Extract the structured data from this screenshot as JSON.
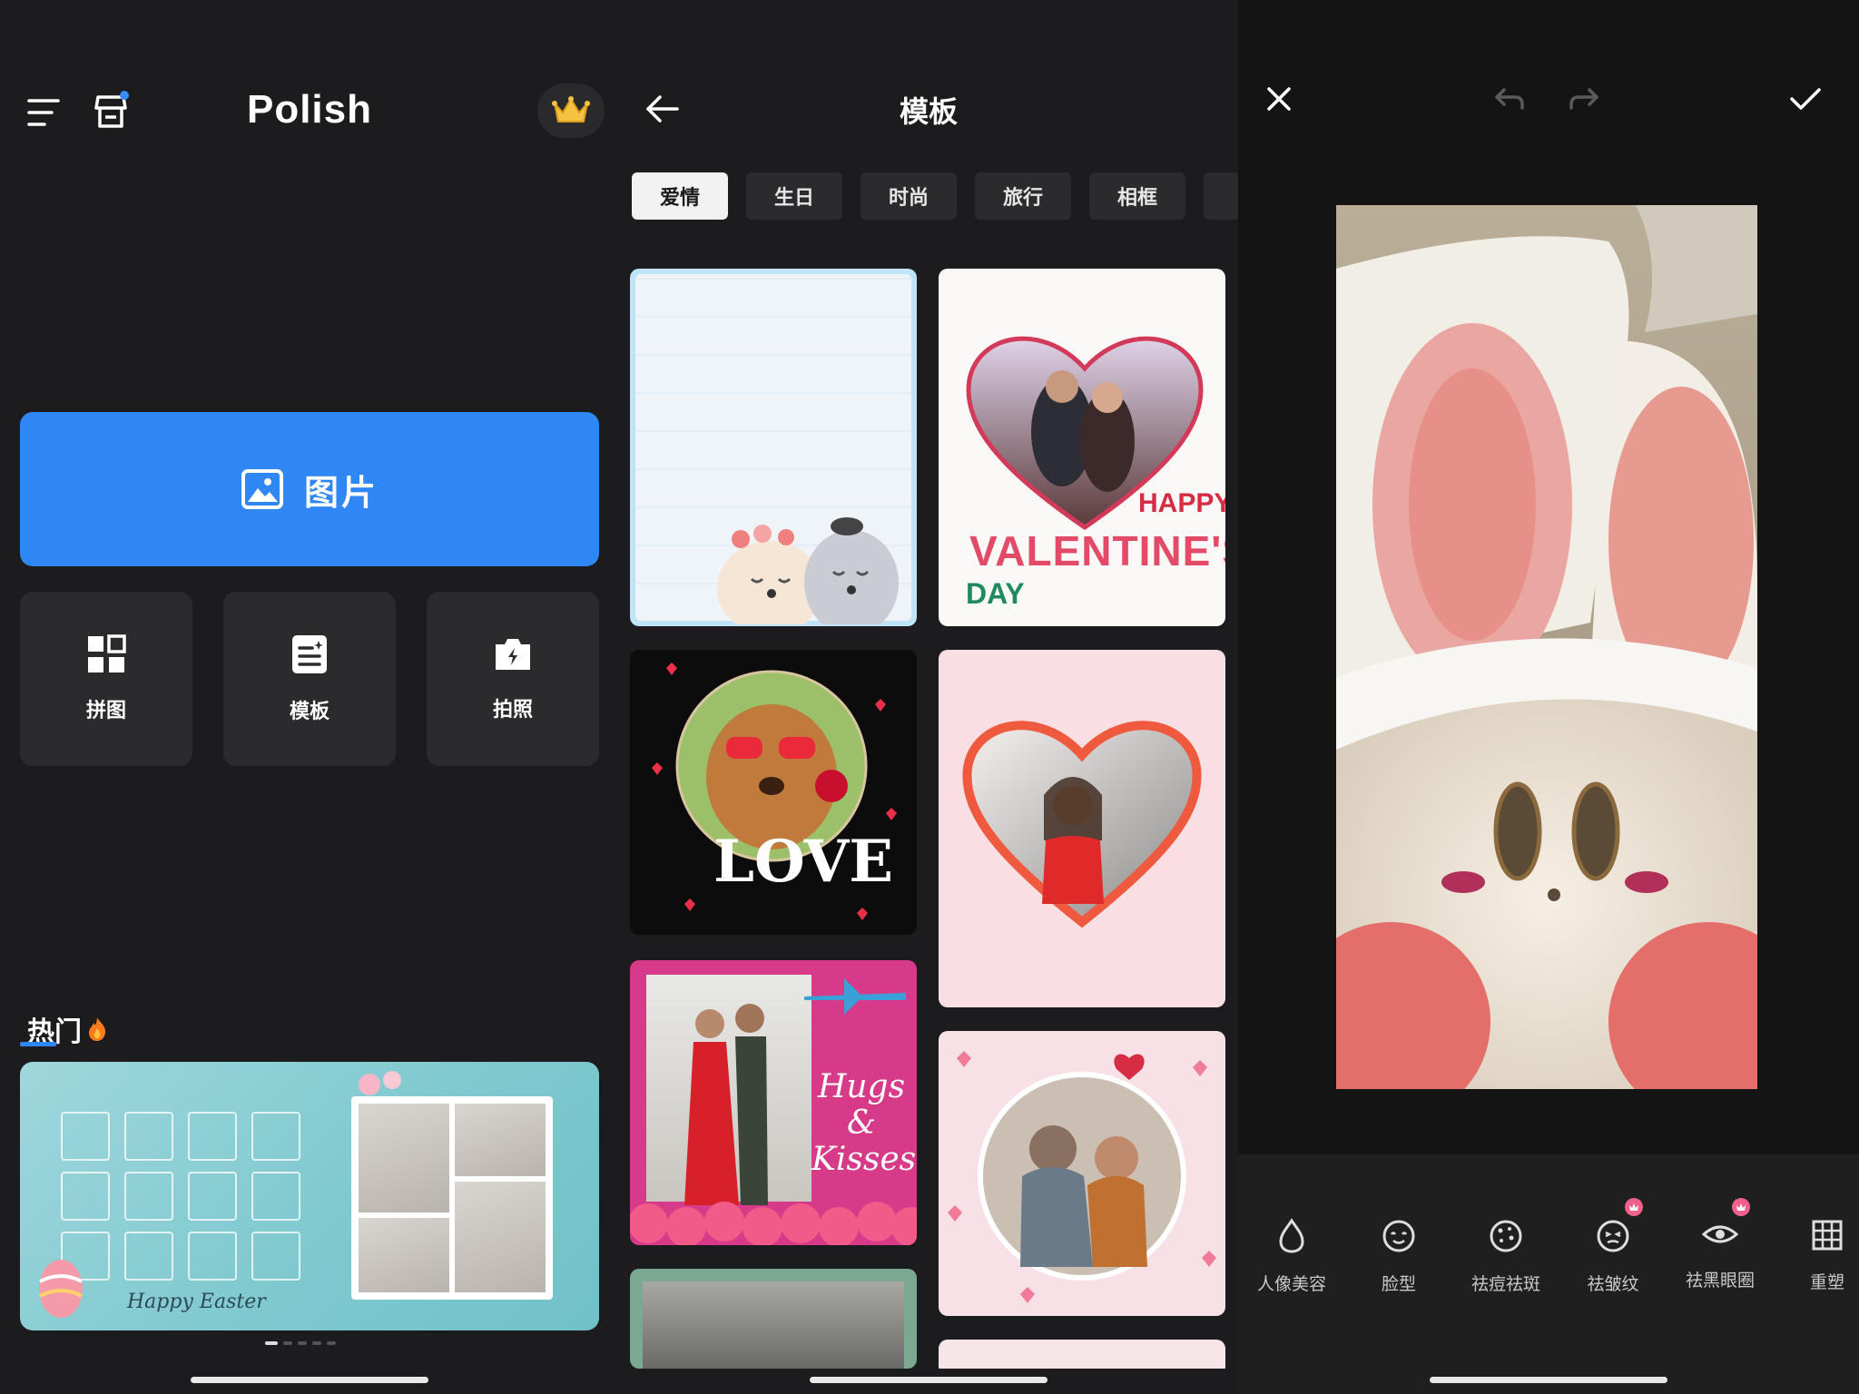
{
  "home": {
    "title": "Polish",
    "photo_button": "图片",
    "tiles": [
      {
        "label": "拼图",
        "icon": "grid-icon"
      },
      {
        "label": "模板",
        "icon": "template-icon"
      },
      {
        "label": "拍照",
        "icon": "camera-icon"
      }
    ],
    "hot_title": "热门",
    "banner_text": "Happy Easter",
    "carousel_pages": 5,
    "carousel_active": 1
  },
  "templates": {
    "title": "模板",
    "tabs": [
      "爱情",
      "生日",
      "时尚",
      "旅行",
      "相框"
    ],
    "active_tab": 0,
    "cards": [
      {
        "name": "template-card-bears",
        "text": ""
      },
      {
        "name": "template-card-valentines",
        "text": "HAPPY VALENTINE'S DAY"
      },
      {
        "name": "template-card-dog-love",
        "text": "LOVE"
      },
      {
        "name": "template-card-heart-frame",
        "text": ""
      },
      {
        "name": "template-card-hugs-kisses",
        "text": "Hugs & Kisses"
      },
      {
        "name": "template-card-circle-couple",
        "text": ""
      }
    ]
  },
  "editor": {
    "tools": [
      {
        "label": "人像美容",
        "icon": "drop-icon",
        "vip": false
      },
      {
        "label": "脸型",
        "icon": "face-icon",
        "vip": false
      },
      {
        "label": "祛痘祛斑",
        "icon": "acne-icon",
        "vip": false
      },
      {
        "label": "祛皱纹",
        "icon": "wrinkle-icon",
        "vip": true
      },
      {
        "label": "祛黑眼圈",
        "icon": "eye-icon",
        "vip": true
      },
      {
        "label": "重塑",
        "icon": "reshape-icon",
        "vip": false
      }
    ]
  },
  "colors": {
    "accent": "#2f87f5",
    "background": "#1c1c1e",
    "tile": "#2b2b2d",
    "vip_badge": "#f0608a"
  }
}
